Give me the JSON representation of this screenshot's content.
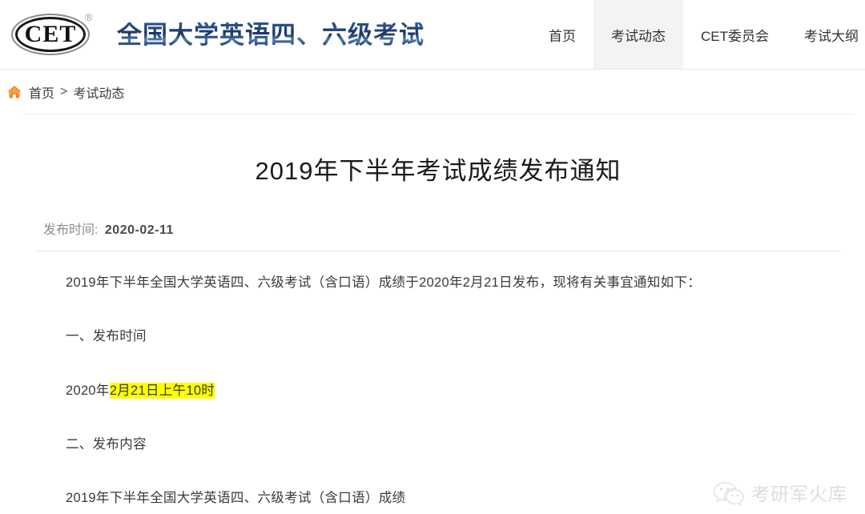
{
  "header": {
    "logo": {
      "mark_text": "CET",
      "registered_symbol": "®",
      "icon_name": "cet-logo-icon"
    },
    "brand_title": "全国大学英语四、六级考试",
    "brand_color": "#1f3b6e",
    "nav": [
      {
        "label": "首页",
        "active": false
      },
      {
        "label": "考试动态",
        "active": true
      },
      {
        "label": "CET委员会",
        "active": false
      },
      {
        "label": "考试大纲",
        "active": false
      }
    ],
    "active_nav_bg": "#f3f3f3"
  },
  "breadcrumb": {
    "home_icon": "home-icon",
    "home_icon_color": "#f08519",
    "items": [
      "首页",
      "考试动态"
    ],
    "separator": ">"
  },
  "article": {
    "title": "2019年下半年考试成绩发布通知",
    "publish_label": "发布时间:",
    "publish_date": "2020-02-11",
    "paragraphs": [
      {
        "text": "2019年下半年全国大学英语四、六级考试（含口语）成绩于2020年2月21日发布，现将有关事宜通知如下：",
        "type": "body"
      },
      {
        "text": "一、发布时间",
        "type": "section"
      },
      {
        "prefix": "2020年",
        "highlight": "2月21日上午10时",
        "suffix": "",
        "type": "highlighted",
        "highlight_color": "#ffff00"
      },
      {
        "text": "二、发布内容",
        "type": "section"
      },
      {
        "text": "2019年下半年全国大学英语四、六级考试（含口语）成绩",
        "type": "body"
      }
    ]
  },
  "watermark": {
    "icon_name": "wechat-icon",
    "text": "考研军火库",
    "color": "#b5b5b5"
  }
}
